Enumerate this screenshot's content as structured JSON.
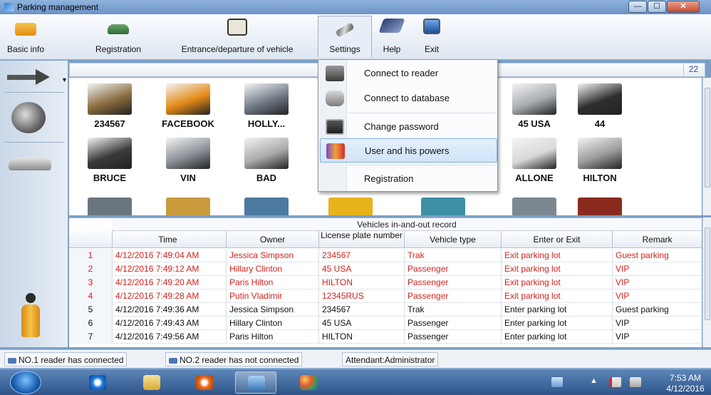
{
  "window": {
    "title": "Parking management",
    "min_glyph": "—",
    "max_glyph": "☐",
    "close_glyph": "✕"
  },
  "toolbar": {
    "basic_info": "Basic info",
    "registration": "Registration",
    "entrance": "Entrance/departure of vehicle",
    "settings": "Settings",
    "help": "Help",
    "exit": "Exit"
  },
  "gallery": {
    "count": "22",
    "vehicles": [
      {
        "name": "234567",
        "color": "#8a6c3f"
      },
      {
        "name": "FACEBOOK",
        "color": "#e28a16"
      },
      {
        "name": "HOLLY...",
        "color": "#6f7a86"
      },
      {
        "name": "45 USA",
        "color": "#a8acb0"
      },
      {
        "name": "44",
        "color": "#2f2f2f"
      },
      {
        "name": "BRUCE",
        "color": "#3a3a3a"
      },
      {
        "name": "VIN",
        "color": "#8a9096"
      },
      {
        "name": "BAD",
        "color": "#a9a9a9"
      },
      {
        "name": "ALLONE",
        "color": "#d9d9d9"
      },
      {
        "name": "HILTON",
        "color": "#9b9b9b"
      }
    ]
  },
  "settings_menu": {
    "items": [
      {
        "label": "Connect to reader"
      },
      {
        "label": "Connect to database"
      },
      {
        "label": "Change password"
      },
      {
        "label": "User and his powers"
      },
      {
        "label": "Registration"
      }
    ]
  },
  "table": {
    "caption": "Vehicles in-and-out record",
    "headers": {
      "time": "Time",
      "owner": "Owner",
      "plate": "License plate number",
      "type": "Vehicle type",
      "enter_exit": "Enter or Exit",
      "remark": "Remark"
    },
    "rows": [
      {
        "num": "1",
        "time": "4/12/2016 7:49:04 AM",
        "owner": "Jessica Simpson",
        "plate": "234567",
        "type": "Trak",
        "enter_exit": "Exit parking lot",
        "remark": "Guest parking",
        "highlight": true
      },
      {
        "num": "2",
        "time": "4/12/2016 7:49:12 AM",
        "owner": "Hillary Clinton",
        "plate": "45 USA",
        "type": "Passenger",
        "enter_exit": "Exit parking lot",
        "remark": "VIP",
        "highlight": true
      },
      {
        "num": "3",
        "time": "4/12/2016 7:49:20 AM",
        "owner": "Paris Hilton",
        "plate": "HILTON",
        "type": "Passenger",
        "enter_exit": "Exit parking lot",
        "remark": "VIP",
        "highlight": true
      },
      {
        "num": "4",
        "time": "4/12/2016 7:49:28 AM",
        "owner": "Putin Vladimir",
        "plate": "12345RUS",
        "type": "Passenger",
        "enter_exit": "Exit parking lot",
        "remark": "VIP",
        "highlight": true
      },
      {
        "num": "5",
        "time": "4/12/2016 7:49:36 AM",
        "owner": "Jessica Simpson",
        "plate": "234567",
        "type": "Trak",
        "enter_exit": "Enter parking lot",
        "remark": "Guest parking",
        "highlight": false
      },
      {
        "num": "6",
        "time": "4/12/2016 7:49:43 AM",
        "owner": "Hillary Clinton",
        "plate": "45 USA",
        "type": "Passenger",
        "enter_exit": "Enter parking lot",
        "remark": "VIP",
        "highlight": false
      },
      {
        "num": "7",
        "time": "4/12/2016 7:49:56 AM",
        "owner": "Paris Hilton",
        "plate": "HILTON",
        "type": "Passenger",
        "enter_exit": "Enter parking lot",
        "remark": "VIP",
        "highlight": false
      }
    ]
  },
  "status": {
    "reader1": "NO.1 reader has connected",
    "reader2": "NO.2 reader has not connected",
    "attendant": "Attendant:Administrator"
  },
  "taskbar": {
    "time": "7:53 AM",
    "date": "4/12/2016"
  },
  "colors": {
    "highlight_row_text": "#d3211c",
    "menu_highlight": "#cfe3f8"
  }
}
